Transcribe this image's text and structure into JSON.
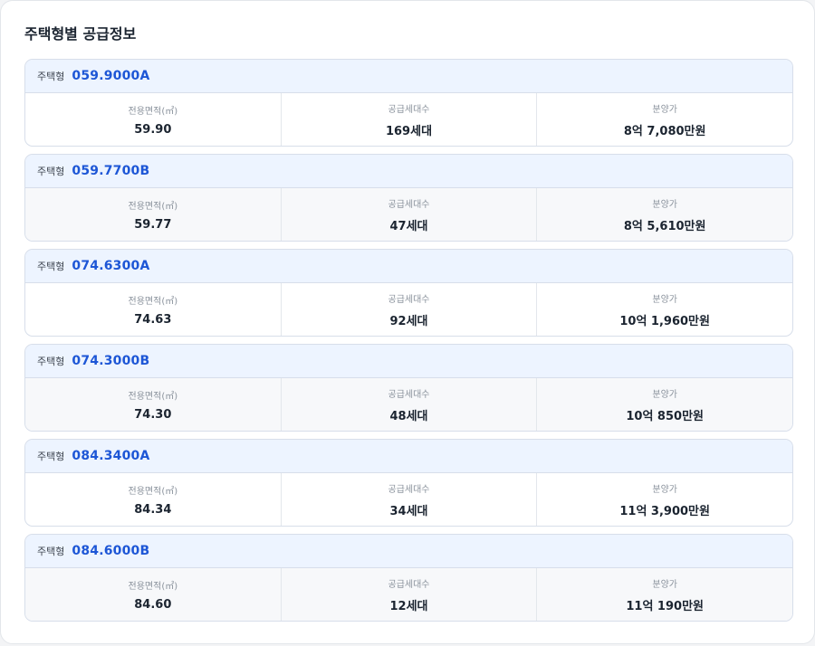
{
  "section": {
    "title": "주택형별 공급정보"
  },
  "labels": {
    "type": "주택형",
    "area": "전용면적(㎡)",
    "units": "공급세대수",
    "price": "분양가"
  },
  "colors": {
    "accent": "#1d56d6",
    "header_bg": "#edf4ff",
    "border": "#d7deea"
  },
  "cards": [
    {
      "code": "059.9000A",
      "area": "59.90",
      "units": "169세대",
      "price": "8억 7,080만원"
    },
    {
      "code": "059.7700B",
      "area": "59.77",
      "units": "47세대",
      "price": "8억 5,610만원"
    },
    {
      "code": "074.6300A",
      "area": "74.63",
      "units": "92세대",
      "price": "10억 1,960만원"
    },
    {
      "code": "074.3000B",
      "area": "74.30",
      "units": "48세대",
      "price": "10억 850만원"
    },
    {
      "code": "084.3400A",
      "area": "84.34",
      "units": "34세대",
      "price": "11억 3,900만원"
    },
    {
      "code": "084.6000B",
      "area": "84.60",
      "units": "12세대",
      "price": "11억 190만원"
    }
  ]
}
